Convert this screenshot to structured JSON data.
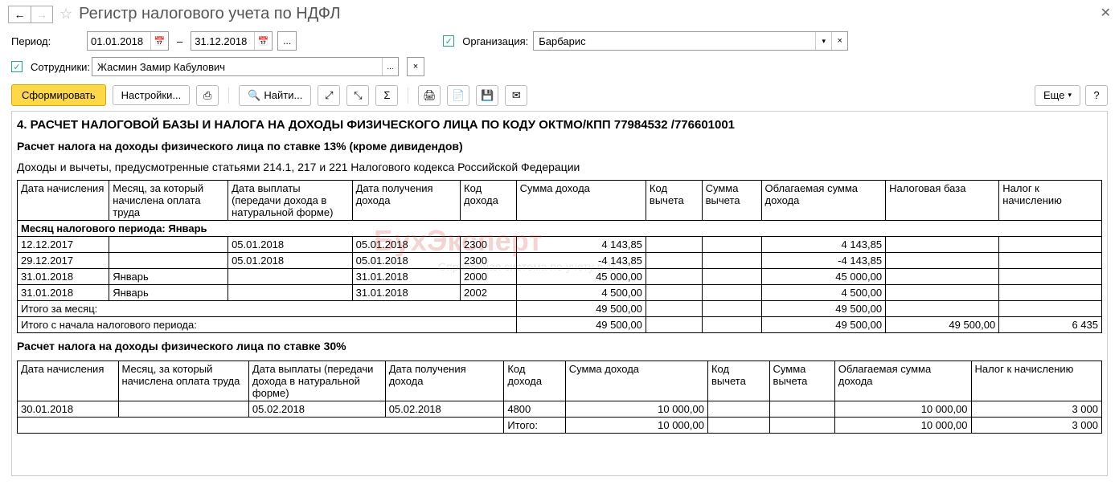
{
  "title": "Регистр налогового учета по НДФЛ",
  "period_label": "Период:",
  "date_from": "01.01.2018",
  "date_to": "31.12.2018",
  "org_label": "Организация:",
  "org_value": "Барбарис",
  "emp_label": "Сотрудники:",
  "emp_value": "Жасмин Замир Кабулович",
  "btn_generate": "Сформировать",
  "btn_settings": "Настройки...",
  "btn_find": "Найти...",
  "btn_more": "Еще",
  "section4_title": "4. РАСЧЕТ НАЛОГОВОЙ БАЗЫ И НАЛОГА НА ДОХОДЫ ФИЗИЧЕСКОГО ЛИЦА ПО КОДУ ОКТМО/КПП 77984532   /776601001",
  "calc13_title": "Расчет налога на доходы физического лица по ставке 13% (кроме дивидендов)",
  "note_text": "Доходы и вычеты, предусмотренные статьями 214.1, 217 и 221 Налогового кодекса Российской Федерации",
  "headers": {
    "c1": "Дата начисления",
    "c2": "Месяц, за который начислена оплата труда",
    "c3": "Дата выплаты (передачи дохода в натуральной форме)",
    "c4": "Дата получения дохода",
    "c5": "Код дохода",
    "c6": "Сумма дохода",
    "c7": "Код вычета",
    "c8": "Сумма вычета",
    "c9": "Облагаемая сумма дохода",
    "c10": "Налоговая база",
    "c11": "Налог к начислению"
  },
  "month_header": "Месяц налогового периода: Январь",
  "rows13": [
    {
      "d": "12.12.2017",
      "m": "",
      "pay": "05.01.2018",
      "rec": "05.01.2018",
      "code": "2300",
      "sum": "4 143,85",
      "vk": "",
      "vs": "",
      "tax": "4 143,85",
      "base": "",
      "nal": ""
    },
    {
      "d": "29.12.2017",
      "m": "",
      "pay": "05.01.2018",
      "rec": "05.01.2018",
      "code": "2300",
      "sum": "-4 143,85",
      "vk": "",
      "vs": "",
      "tax": "-4 143,85",
      "base": "",
      "nal": ""
    },
    {
      "d": "31.01.2018",
      "m": "Январь",
      "pay": "",
      "rec": "31.01.2018",
      "code": "2000",
      "sum": "45 000,00",
      "vk": "",
      "vs": "",
      "tax": "45 000,00",
      "base": "",
      "nal": ""
    },
    {
      "d": "31.01.2018",
      "m": "Январь",
      "pay": "",
      "rec": "31.01.2018",
      "code": "2002",
      "sum": "4 500,00",
      "vk": "",
      "vs": "",
      "tax": "4 500,00",
      "base": "",
      "nal": ""
    }
  ],
  "total_month_label": "Итого за месяц:",
  "total_month_sum": "49 500,00",
  "total_month_tax": "49 500,00",
  "total_period_label": "Итого с начала налогового периода:",
  "total_period_sum": "49 500,00",
  "total_period_tax": "49 500,00",
  "total_period_base": "49 500,00",
  "total_period_nal": "6 435",
  "calc30_title": "Расчет налога на доходы физического лица по ставке 30%",
  "headers30": {
    "c1": "Дата начисления",
    "c2": "Месяц, за который начислена оплата труда",
    "c3": "Дата выплаты (передачи дохода в натуральной форме)",
    "c4": "Дата получения дохода",
    "c5": "Код дохода",
    "c6": "Сумма дохода",
    "c7": "Код вычета",
    "c8": "Сумма вычета",
    "c9": "Облагаемая сумма дохода",
    "c10": "Налог к начислению"
  },
  "row30": {
    "d": "30.01.2018",
    "m": "",
    "pay": "05.02.2018",
    "rec": "05.02.2018",
    "code": "4800",
    "sum": "10 000,00",
    "vk": "",
    "vs": "",
    "tax": "10 000,00",
    "nal": "3 000"
  },
  "total30_label": "Итого:",
  "total30_sum": "10 000,00",
  "total30_tax": "10 000,00",
  "total30_nal": "3 000",
  "watermark": "БухЭксперт",
  "watermark2": "Справочная система по учету в 1С"
}
